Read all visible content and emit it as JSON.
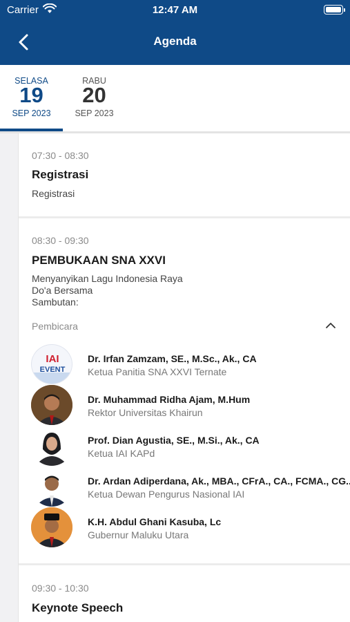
{
  "status_bar": {
    "carrier": "Carrier",
    "time": "12:47 AM"
  },
  "header": {
    "title": "Agenda"
  },
  "date_tabs": [
    {
      "dow": "SELASA",
      "day": "19",
      "month": "SEP 2023",
      "active": true
    },
    {
      "dow": "RABU",
      "day": "20",
      "month": "SEP 2023",
      "active": false
    }
  ],
  "sessions": [
    {
      "time": "07:30 - 08:30",
      "title": "Registrasi",
      "description": [
        "Registrasi"
      ]
    },
    {
      "time": "08:30 - 09:30",
      "title": "PEMBUKAAN SNA XXVI",
      "description": [
        "Menyanyikan Lagu Indonesia Raya",
        "Do'a Bersama",
        "Sambutan:"
      ],
      "speakers_label": "Pembicara",
      "speakers": [
        {
          "name": "Dr. Irfan Zamzam, SE., M.Sc., Ak., CA",
          "role": "Ketua Panitia SNA XXVI Ternate",
          "avatar": "logo-avatar",
          "avatar_text_1": "IAI",
          "avatar_text_2": "EVENT"
        },
        {
          "name": "Dr. Muhammad Ridha Ajam, M.Hum",
          "role": "Rektor Universitas Khairun",
          "avatar": "photo-avatar"
        },
        {
          "name": "Prof. Dian Agustia, SE., M.Si., Ak., CA",
          "role": "Ketua IAI KAPd",
          "avatar": "photo-avatar"
        },
        {
          "name": "Dr. Ardan Adiperdana, Ak., MBA., CFrA., CA., FCMA., CG...",
          "role": "Ketua Dewan Pengurus Nasional IAI",
          "avatar": "photo-avatar"
        },
        {
          "name": "K.H. Abdul Ghani Kasuba, Lc",
          "role": "Gubernur Maluku Utara",
          "avatar": "photo-avatar"
        }
      ]
    },
    {
      "time": "09:30 - 10:30",
      "title": "Keynote Speech"
    }
  ],
  "colors": {
    "primary": "#0f4a87",
    "rail": "#f1f1f3",
    "muted": "#8a8a8a"
  }
}
